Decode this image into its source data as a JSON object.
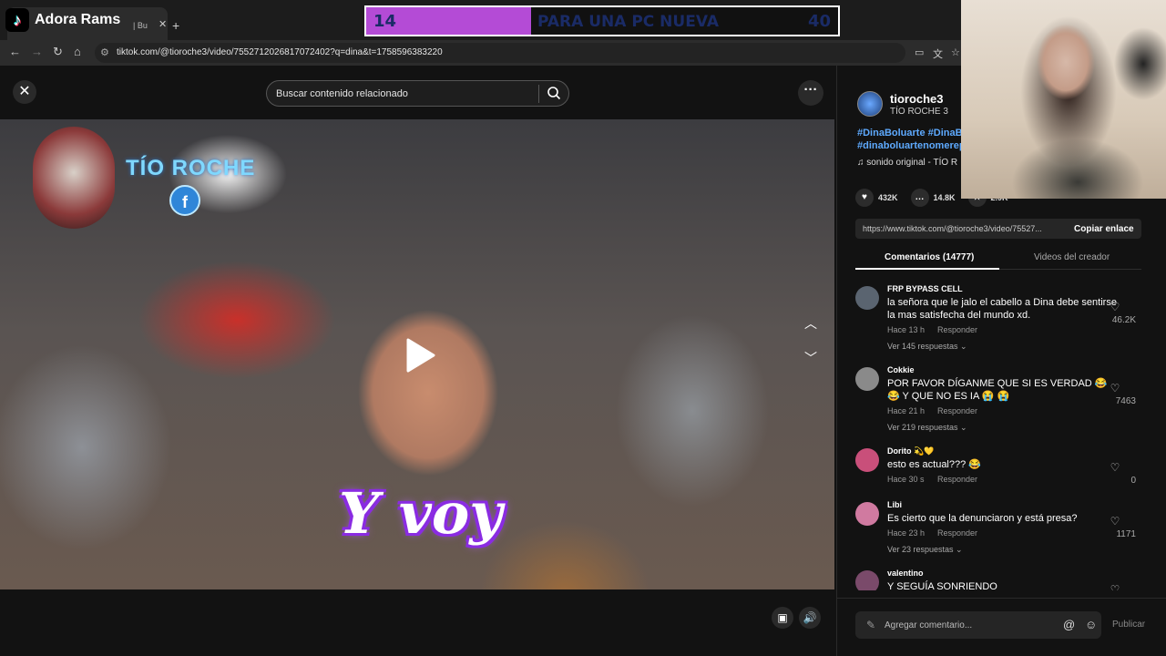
{
  "browser": {
    "tab_title": "| Bu",
    "tab_close": "✕",
    "new_tab": "+",
    "url": "tiktok.com/@tioroche3/video/7552712026817072402?q=dina&t=1758596383220"
  },
  "stream": {
    "brand_name": "Adora Rams",
    "goal_current": "14",
    "goal_label": "PARA UNA PC NUEVA",
    "goal_max": "40",
    "goal_progress": 0.35,
    "goal_fill_color": "#b44bd6"
  },
  "video": {
    "search_placeholder": "Buscar contenido relacionado",
    "channel_watermark": "TÍO ROCHE",
    "fb_badge": "f",
    "caption": "Y voy"
  },
  "author": {
    "handle": "tioroche3",
    "name": "TÍO ROCHE 3",
    "hashtags_line1": "#DinaBoluarte #DinaB",
    "hashtags_line2": "#dinaboluartenomerep",
    "sound": "♫  sonido original - TÍO R"
  },
  "stats": {
    "likes": "432K",
    "comments": "14.8K",
    "saves": "2.9K"
  },
  "link": {
    "url": "https://www.tiktok.com/@tioroche3/video/75527...",
    "copy_label": "Copiar enlace"
  },
  "tabs": {
    "comments": "Comentarios (14777)",
    "creator_videos": "Videos del creador"
  },
  "comments": [
    {
      "user": "FRP BYPASS CELL",
      "text": "la señora que le jalo el cabello a Dina debe sentirse la mas satisfecha del mundo xd.",
      "time": "Hace 13 h",
      "reply": "Responder",
      "more": "Ver 145 respuestas ⌄",
      "likes": "46.2K",
      "avatar_color": "#5a6470"
    },
    {
      "user": "Cokkie",
      "text": "POR FAVOR DÍGANME QUE SI ES VERDAD 😂 😂 Y QUE NO ES IA 😭 😭",
      "time": "Hace 21 h",
      "reply": "Responder",
      "more": "Ver 219 respuestas ⌄",
      "likes": "7463",
      "avatar_color": "#8a8a8a"
    },
    {
      "user": "Dorito 💫💛",
      "text": "esto es actual??? 😂",
      "time": "Hace 30 s",
      "reply": "Responder",
      "more": "",
      "likes": "0",
      "avatar_color": "#c94f7a"
    },
    {
      "user": "Libi",
      "text": "Es cierto que la denunciaron y está presa?",
      "time": "Hace 23 h",
      "reply": "Responder",
      "more": "Ver 23 respuestas ⌄",
      "likes": "1171",
      "avatar_color": "#d07aa0"
    },
    {
      "user": "valentino",
      "text": "Y SEGUÍA SONRIENDO JAKAJSKSKSSKKSKSKSS",
      "time": "",
      "reply": "",
      "more": "",
      "likes": "",
      "avatar_color": "#7a4a6a"
    }
  ],
  "compose": {
    "placeholder": "Agregar comentario...",
    "publish": "Publicar"
  }
}
